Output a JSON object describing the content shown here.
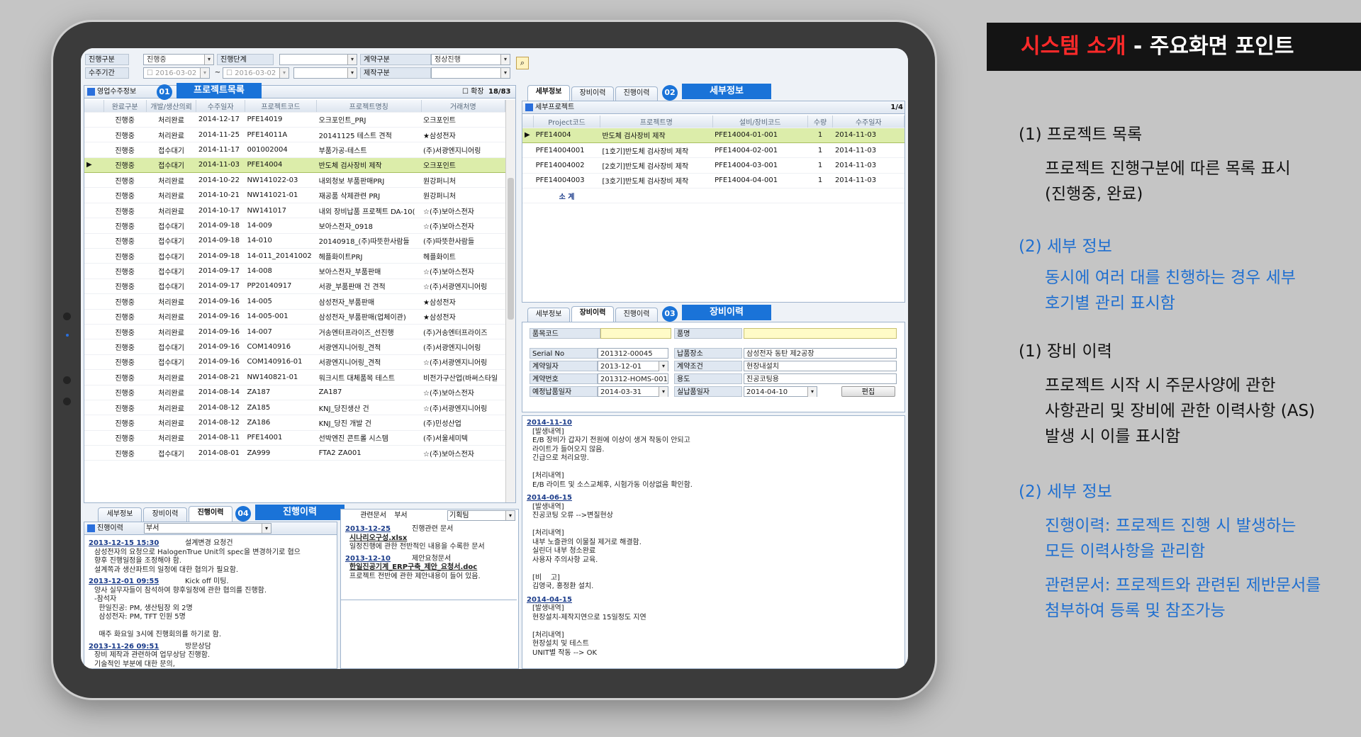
{
  "header": {
    "title_red": "시스템 소개",
    "title_rest": " - 주요화면 포인트"
  },
  "filters": {
    "status_label": "진행구분",
    "status_value": "진행중",
    "stage_label": "진행단계",
    "stage_value": "",
    "contract_label": "계약구분",
    "contract_value": "정상진행",
    "period_label": "수주기간",
    "period_from": "2016-03-02",
    "period_sep": "~",
    "period_to": "2016-03-02",
    "maker_label": "제작구분",
    "maker_value": ""
  },
  "project_panel": {
    "title": "영업수주정보",
    "badge": "01",
    "callout": "프로젝트목록",
    "expand_label": "확장",
    "page_info": "18/83",
    "columns": [
      "완료구분",
      "개발/생산의뢰",
      "수주일자",
      "프로젝트코드",
      "프로젝트명칭",
      "거래처명"
    ],
    "rows": [
      [
        "진행중",
        "처리완료",
        "2014-12-17",
        "PFE14019",
        "오크포인트_PRJ",
        "오크포인트"
      ],
      [
        "진행중",
        "처리완료",
        "2014-11-25",
        "PFE14011A",
        "20141125 테스트 견적",
        "★삼성전자"
      ],
      [
        "진행중",
        "접수대기",
        "2014-11-17",
        "001002004",
        "부품가공-테스트",
        "(주)서광엔지니어링"
      ],
      [
        "진행중",
        "접수대기",
        "2014-11-03",
        "PFE14004",
        "반도체 검사장비 제작",
        "오크포인트"
      ],
      [
        "진행중",
        "처리완료",
        "2014-10-22",
        "NW141022-03",
        "내외청보 부품판매PRJ",
        "원강퍼니처"
      ],
      [
        "진행중",
        "처리완료",
        "2014-10-21",
        "NW141021-01",
        "재공품 삭제관련 PRJ",
        "원강퍼니처"
      ],
      [
        "진행중",
        "처리완료",
        "2014-10-17",
        "NW141017",
        "내외 장비납품 프로젝트 DA-10(",
        "☆(주)보아스전자"
      ],
      [
        "진행중",
        "접수대기",
        "2014-09-18",
        "14-009",
        "보아스전자_0918",
        "☆(주)보아스전자"
      ],
      [
        "진행중",
        "접수대기",
        "2014-09-18",
        "14-010",
        "20140918_(주)따뜻한사람들",
        "(주)따뜻한사람들"
      ],
      [
        "진행중",
        "접수대기",
        "2014-09-18",
        "14-011_20141002",
        "헤플화이트PRJ",
        "헤플화이트"
      ],
      [
        "진행중",
        "접수대기",
        "2014-09-17",
        "14-008",
        "보아스전자_부품판매",
        "☆(주)보아스전자"
      ],
      [
        "진행중",
        "접수대기",
        "2014-09-17",
        "PP20140917",
        "서광_부품판매 건 견적",
        "☆(주)서광엔지니어링"
      ],
      [
        "진행중",
        "처리완료",
        "2014-09-16",
        "14-005",
        "삼성전자_부품판매",
        "★삼성전자"
      ],
      [
        "진행중",
        "처리완료",
        "2014-09-16",
        "14-005-001",
        "삼성전자_부품판매(업체이관)",
        "★삼성전자"
      ],
      [
        "진행중",
        "처리완료",
        "2014-09-16",
        "14-007",
        "거송엔터프라이즈_선진행",
        "(주)거송엔터프라이즈"
      ],
      [
        "진행중",
        "접수대기",
        "2014-09-16",
        "COM140916",
        "서광엔지니어링_견적",
        "(주)서광엔지니어링"
      ],
      [
        "진행중",
        "접수대기",
        "2014-09-16",
        "COM140916-01",
        "서광엔지니어링_견적",
        "☆(주)서광엔지니어링"
      ],
      [
        "진행중",
        "처리완료",
        "2014-08-21",
        "NW140821-01",
        "워크시트 대체품목 테스트",
        "비전가구산업(바써스타일"
      ],
      [
        "진행중",
        "처리완료",
        "2014-08-14",
        "ZA187",
        "ZA187",
        "☆(주)보아스전자"
      ],
      [
        "진행중",
        "처리완료",
        "2014-08-12",
        "ZA185",
        "KNJ_당진생산 건",
        "☆(주)서광엔지니어링"
      ],
      [
        "진행중",
        "처리완료",
        "2014-08-12",
        "ZA186",
        "KNJ_당진 개발 건",
        "(주)민성산업"
      ],
      [
        "진행중",
        "처리완료",
        "2014-08-11",
        "PFE14001",
        "선박엔진 콘트롤 시스템",
        "(주)서울세미텍"
      ],
      [
        "진행중",
        "접수대기",
        "2014-08-01",
        "ZA999",
        "FTA2 ZA001",
        "☆(주)보아스전자"
      ]
    ]
  },
  "detail_panel": {
    "tabs": [
      "세부정보",
      "장비이력",
      "진행이력"
    ],
    "badge": "02",
    "callout": "세부정보",
    "title": "세부프로젝트",
    "page_info": "1/4",
    "columns": [
      "Project코드",
      "프로젝트명",
      "설비/장비코드",
      "수량",
      "수주일자"
    ],
    "rows": [
      [
        "PFE14004",
        "반도체 검사장비 제작",
        "PFE14004-01-001",
        "1",
        "2014-11-03"
      ],
      [
        "PFE14004001",
        "[1호기]반도체 검사장비 제작",
        "PFE14004-02-001",
        "1",
        "2014-11-03"
      ],
      [
        "PFE14004002",
        "[2호기]반도체 검사장비 제작",
        "PFE14004-03-001",
        "1",
        "2014-11-03"
      ],
      [
        "PFE14004003",
        "[3호기]반도체 검사장비 제작",
        "PFE14004-04-001",
        "1",
        "2014-11-03"
      ]
    ],
    "total_label": "소 계"
  },
  "equip_panel": {
    "tabs": [
      "세부정보",
      "장비이력",
      "진행이력"
    ],
    "badge": "03",
    "callout": "장비이력",
    "item_code_label": "품목코드",
    "item_code": "",
    "item_name_label": "품명",
    "item_name": "",
    "serial_label": "Serial No",
    "serial": "201312-00045",
    "place_label": "납품장소",
    "place": "삼성전자 동탄 제2공장",
    "contract_date_label": "계약일자",
    "contract_date": "2013-12-01",
    "terms_label": "계약조건",
    "terms": "현장내설치",
    "contract_no_label": "계약번호",
    "contract_no": "201312-HOMS-001",
    "use_label": "용도",
    "use": "진공코팅용",
    "planned_label": "예정납품일자",
    "planned": "2014-03-31",
    "actual_label": "실납품일자",
    "actual": "2014-04-10",
    "edit_button": "편집",
    "entries": [
      {
        "date": "2014-11-10",
        "text": "[발생내역]\nE/B 장비가 갑자기 전원에 이상이 생겨 작동이 안되고\n라이트가 들어오지 않음.\n긴급으로 처리요망.\n\n[처리내역]\nE/B 라이트 및 소스교체후, 시험가동 이상없음 확인함."
      },
      {
        "date": "2014-06-15",
        "text": "[발생내역]\n진공코팅 오류 -->변질현상\n\n[처리내역]\n내부 노즐관의 이물질 제거로 해결함.\n실린더 내부 청소완료\n사용자 주의사항 교육.\n\n[비    고]\n김영국, 홍정환 설치."
      },
      {
        "date": "2014-04-15",
        "text": "[발생내역]\n현장설치-제작지연으로 15일정도 지연\n\n[처리내역]\n현장설치 및 테스트\nUNIT별 작동 --> OK"
      }
    ]
  },
  "progress_panel": {
    "tabs": [
      "세부정보",
      "장비이력",
      "진행이력"
    ],
    "badge": "04",
    "callout": "진행이력",
    "title": "진행이력",
    "dept_label": "부서",
    "dept_value": "",
    "entries": [
      {
        "date": "2013-12-15 15:30",
        "subject": "설계변경 요청건",
        "text": "삼성전자의 요청으로 HalogenTrue Unit의 spec을 변경하기로 협으\n향후 진행일정을 조정해야 함.\n설계쪽과 생산파트의 일정에 대한 협의가 필요함."
      },
      {
        "date": "2013-12-01 09:55",
        "subject": "Kick off 미팅.",
        "text": "양사 실무자들이 참석하여 향후일정에 관한 협의를 진행함.\n-참석자\n  한일진공: PM, 생산팀장 외 2명\n  삼성전자: PM, TFT 인원 5명\n\n  매주 화요일 3시에 진행회의를 하기로 함."
      },
      {
        "date": "2013-11-26 09:51",
        "subject": "방문상담",
        "text": "장비 제작과 관련하여 업무상담 진행함.\n기술적인 부분에 대한 문의,\n견적제출을 원함.\n다음주 목요일까지 견적주기로 함."
      }
    ]
  },
  "docs_panel": {
    "tab_label": "관련문서",
    "dept_label": "부서",
    "dept_value": "기획팀",
    "entries": [
      {
        "date": "2013-12-25",
        "subject": "진행관련 문서",
        "file": "시나리오구성.xlsx",
        "text": "일정진행에 관한 전반적인 내용을 수록한 문서"
      },
      {
        "date": "2013-12-10",
        "subject": "제안요청문서",
        "file": "한일진공기계_ERP구축_제안_요청서.doc",
        "text": "프로젝트 전반에 관한 제안내용이 들어 있음."
      }
    ]
  },
  "notes": [
    {
      "text": "(1) 프로젝트 목록",
      "color": "blk"
    },
    {
      "text": "프로젝트 진행구분에 따른 목록 표시",
      "color": "blk"
    },
    {
      "text": "(진행중, 완료)",
      "color": "blk"
    },
    {
      "text": "(2) 세부 정보",
      "color": "blu"
    },
    {
      "text": "동시에 여러 대를 친행하는 경우 세부",
      "color": "blu"
    },
    {
      "text": "호기별 관리 표시함",
      "color": "blu"
    },
    {
      "text": "(1) 장비 이력",
      "color": "blk"
    },
    {
      "text": "프로젝트 시작 시 주문사양에 관한",
      "color": "blk"
    },
    {
      "text": "사항관리 및 장비에 관한 이력사항 (AS)",
      "color": "blk"
    },
    {
      "text": "발생 시 이를 표시함",
      "color": "blk"
    },
    {
      "text": "(2) 세부 정보",
      "color": "blu"
    },
    {
      "text": "진행이력: 프로젝트 진행 시 발생하는",
      "color": "blu"
    },
    {
      "text": "모든 이력사항을 관리함",
      "color": "blu"
    },
    {
      "text": "관련문서: 프로젝트와 관련된 제반문서를",
      "color": "blu"
    },
    {
      "text": "첨부하여 등록 및 참조가능",
      "color": "blu"
    }
  ]
}
